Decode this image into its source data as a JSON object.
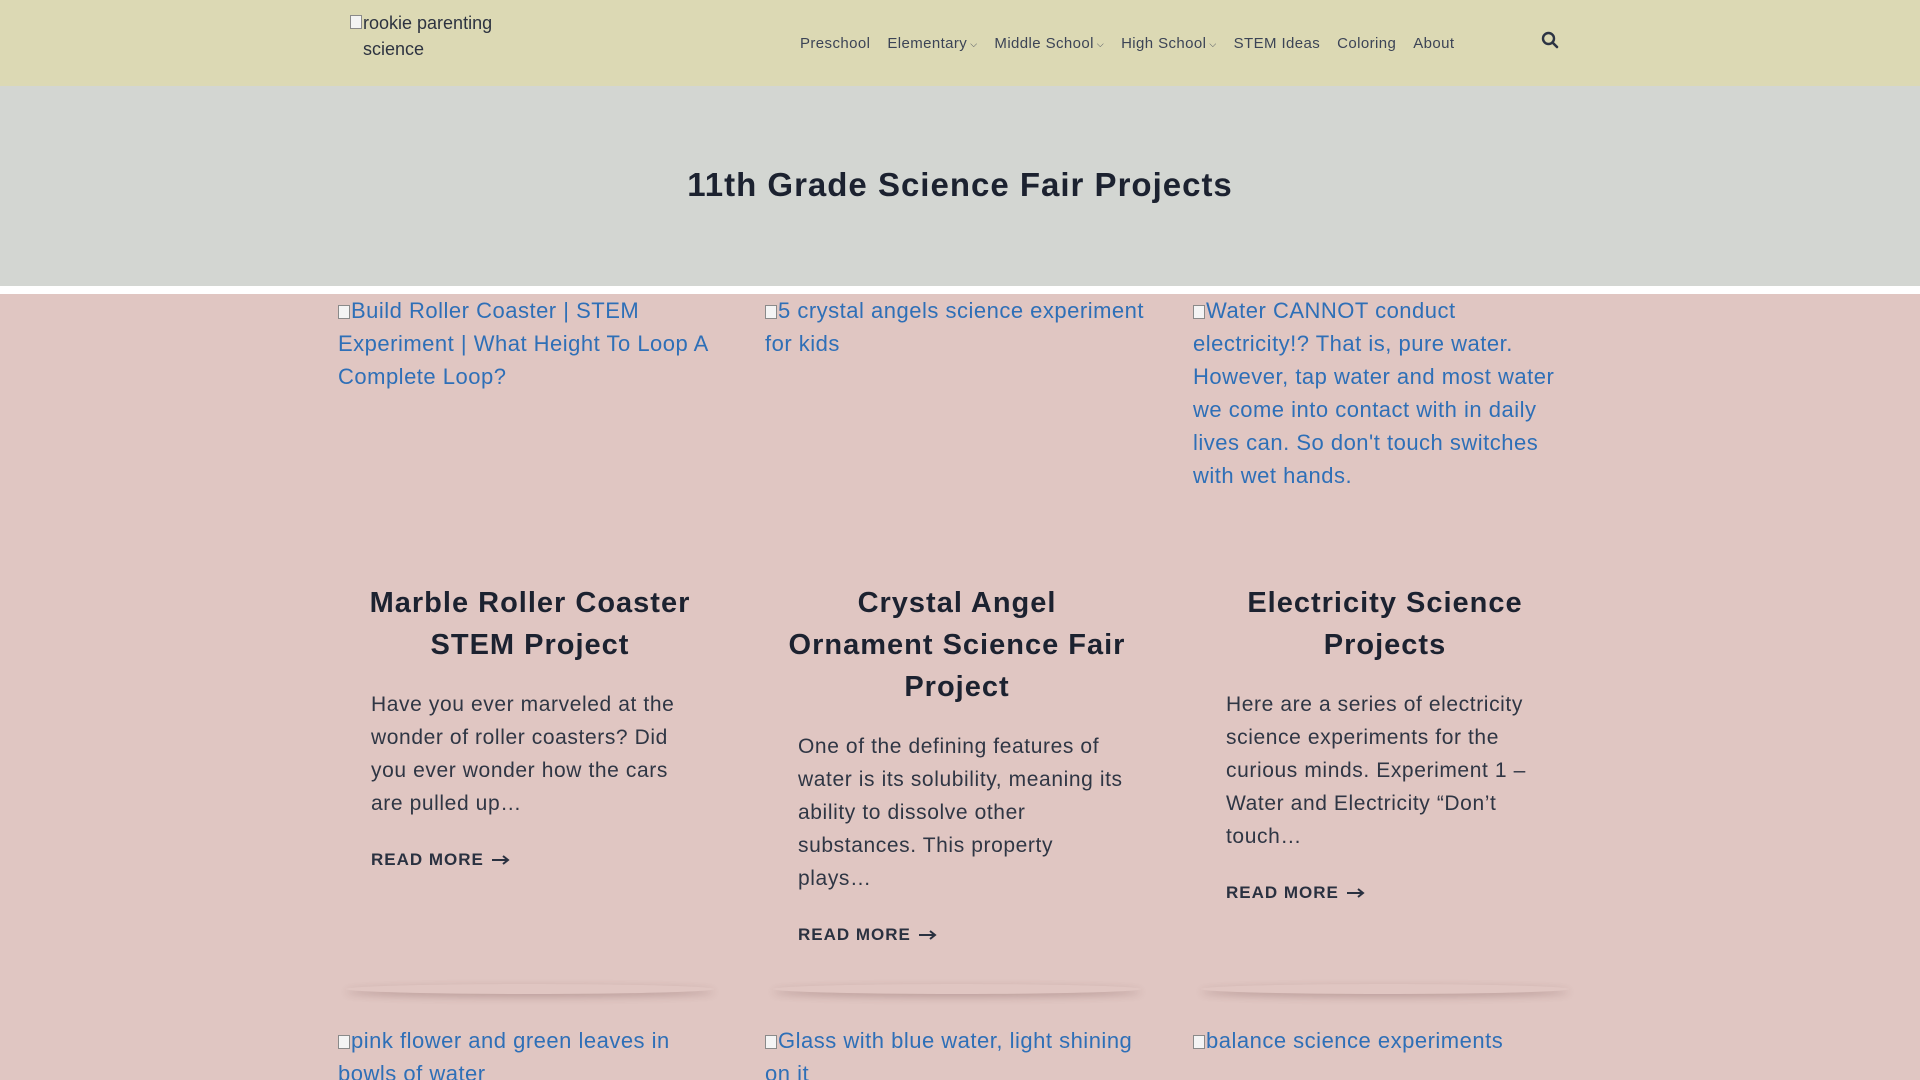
{
  "header": {
    "logo_alt": "rookie parenting science",
    "nav": [
      {
        "label": "Preschool",
        "dropdown": false
      },
      {
        "label": "Elementary",
        "dropdown": true
      },
      {
        "label": "Middle School",
        "dropdown": true
      },
      {
        "label": "High School",
        "dropdown": true
      },
      {
        "label": "STEM Ideas",
        "dropdown": false
      },
      {
        "label": "Coloring",
        "dropdown": false
      },
      {
        "label": "About",
        "dropdown": false
      }
    ],
    "caret": "⌵",
    "search_icon": "search-icon"
  },
  "hero": {
    "title": "11th Grade Science Fair Projects"
  },
  "posts": [
    {
      "image_alt": "Build Roller Coaster | STEM Experiment | What Height To Loop A Complete Loop?",
      "title": "Marble Roller Coaster STEM Project",
      "excerpt": "Have you ever marveled at the wonder of roller coasters? Did you ever wonder how the cars are pulled up…",
      "read_more": "READ MORE"
    },
    {
      "image_alt": "5 crystal angels science experiment for kids",
      "title": "Crystal Angel Ornament Science Fair Project",
      "excerpt": "One of the defining features of water is its solubility, meaning its ability to dissolve other substances. This property plays…",
      "read_more": "READ MORE"
    },
    {
      "image_alt": "Water CANNOT conduct electricity!? That is, pure water. However, tap water and most water we come into contact with in daily lives can. So don't touch switches with wet hands.",
      "title": "Electricity Science Projects",
      "excerpt": "Here are a series of electricity science experiments for the curious minds. Experiment 1 – Water and Electricity “Don’t touch…",
      "read_more": "READ MORE"
    }
  ],
  "next_row": [
    {
      "image_alt": "pink flower and green leaves in bowls of water"
    },
    {
      "image_alt": "Glass with blue water, light shining on it"
    },
    {
      "image_alt": "balance science experiments"
    }
  ],
  "colors": {
    "header_bg": "#dcd9b4",
    "hero_bg": "#d3d6d2",
    "page_bg": "#e0c6c2",
    "link_blue": "#2e6fb7"
  }
}
